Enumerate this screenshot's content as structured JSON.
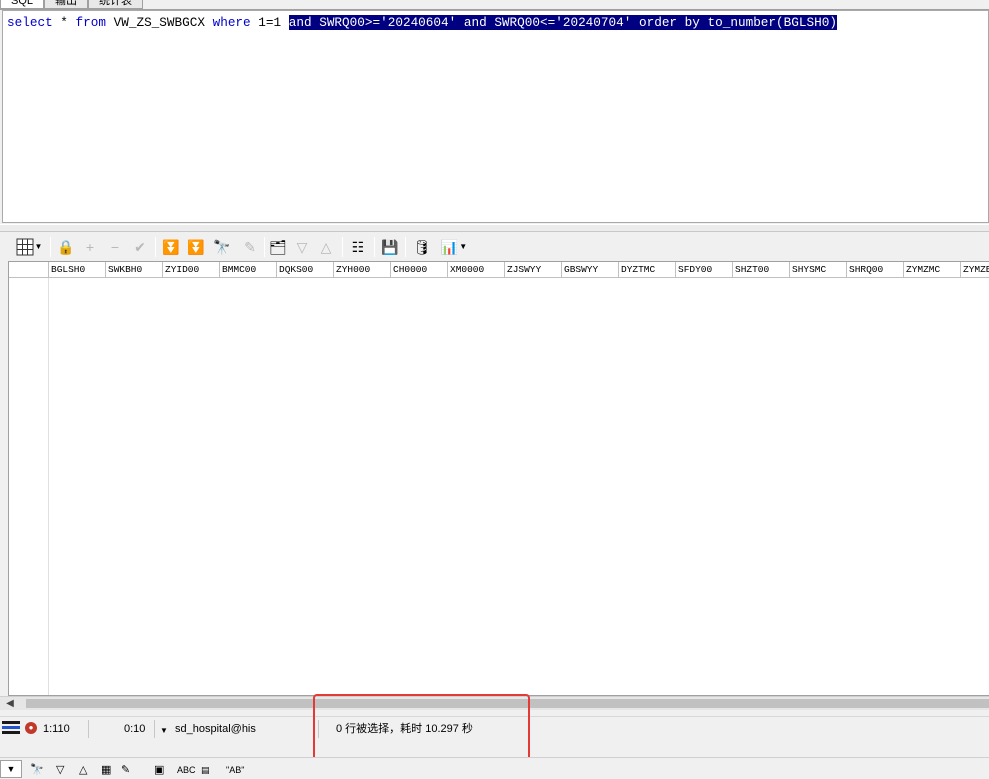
{
  "tabs": [
    "SQL",
    "输出",
    "统计表"
  ],
  "editor": {
    "sql_keyword_select": "select",
    "sql_plain_1": " * ",
    "sql_keyword_from": "from",
    "sql_plain_2": " VW_ZS_SWBGCX ",
    "sql_keyword_where": "where",
    "sql_plain_3": " 1=1 ",
    "sql_selected": "and SWRQ00>='20240604' and SWRQ00<='20240704' order by to_number(BGLSH0)"
  },
  "grid": {
    "columns": [
      "BGLSH0",
      "SWKBH0",
      "ZYID00",
      "BMMC00",
      "DQKS00",
      "ZYH000",
      "CH0000",
      "XM0000",
      "ZJSWYY",
      "GBSWYY",
      "DYZTMC",
      "SFDY00",
      "SHZT00",
      "SHYSMC",
      "SHRQ00",
      "ZYMZMC",
      "ZYMZBM"
    ]
  },
  "status": {
    "cursor_pos": "1:110",
    "elapsed_short": "0:10",
    "connection": "sd_hospital@his",
    "message": "0 行被选择，耗时 10.297 秒"
  },
  "findbar": {
    "abc_label": "ABC",
    "quote_label": "\"AB\""
  },
  "colors": {
    "selection_bg": "#000080",
    "keyword": "#0000cc",
    "highlight_box": "#e53935"
  }
}
